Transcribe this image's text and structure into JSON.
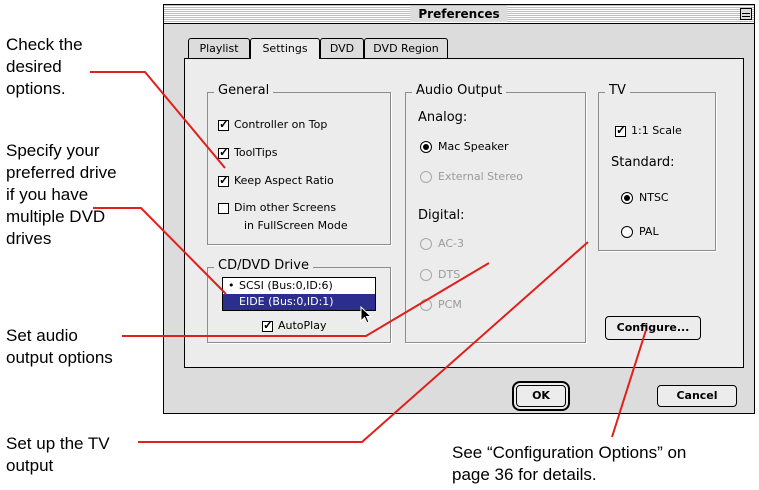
{
  "annotations": {
    "check_options": [
      "Check the",
      "desired",
      "options."
    ],
    "specify_drive": [
      "Specify your",
      "preferred drive",
      "if you have",
      "multiple DVD",
      "drives"
    ],
    "audio_output": [
      "Set audio",
      "output options"
    ],
    "tv_output": [
      "Set up the TV",
      "output"
    ],
    "config_ref": [
      "See “Configuration Options” on",
      "page 36 for details."
    ]
  },
  "window": {
    "title": "Preferences",
    "tabs": [
      "Playlist",
      "Settings",
      "DVD",
      "DVD Region"
    ],
    "active_tab": "Settings"
  },
  "general": {
    "title": "General",
    "options": [
      {
        "label": "Controller on Top",
        "checked": true
      },
      {
        "label": "ToolTips",
        "checked": true
      },
      {
        "label": "Keep Aspect Ratio",
        "checked": true
      },
      {
        "label": "Dim other Screens",
        "label2": "in FullScreen Mode",
        "checked": false
      }
    ]
  },
  "drive": {
    "title": "CD/DVD Drive",
    "items": [
      "SCSI (Bus:0,ID:6)",
      "EIDE (Bus:0,ID:1)"
    ],
    "selected_index": 1,
    "autoplay_label": "AutoPlay",
    "autoplay_checked": true
  },
  "audio": {
    "title": "Audio Output",
    "analog_label": "Analog:",
    "analog_options": [
      {
        "label": "Mac Speaker",
        "selected": true,
        "enabled": true
      },
      {
        "label": "External Stereo",
        "selected": false,
        "enabled": false
      }
    ],
    "digital_label": "Digital:",
    "digital_options": [
      {
        "label": "AC-3",
        "enabled": false
      },
      {
        "label": "DTS",
        "enabled": false
      },
      {
        "label": "PCM",
        "enabled": false
      }
    ]
  },
  "tv": {
    "title": "TV",
    "scale_label": "1:1 Scale",
    "scale_checked": true,
    "standard_label": "Standard:",
    "standards": [
      {
        "label": "NTSC",
        "selected": true
      },
      {
        "label": "PAL",
        "selected": false
      }
    ]
  },
  "buttons": {
    "configure": "Configure...",
    "ok": "OK",
    "cancel": "Cancel"
  },
  "colors": {
    "callout_line": "#e0201b",
    "selection": "#2b2e8c"
  }
}
